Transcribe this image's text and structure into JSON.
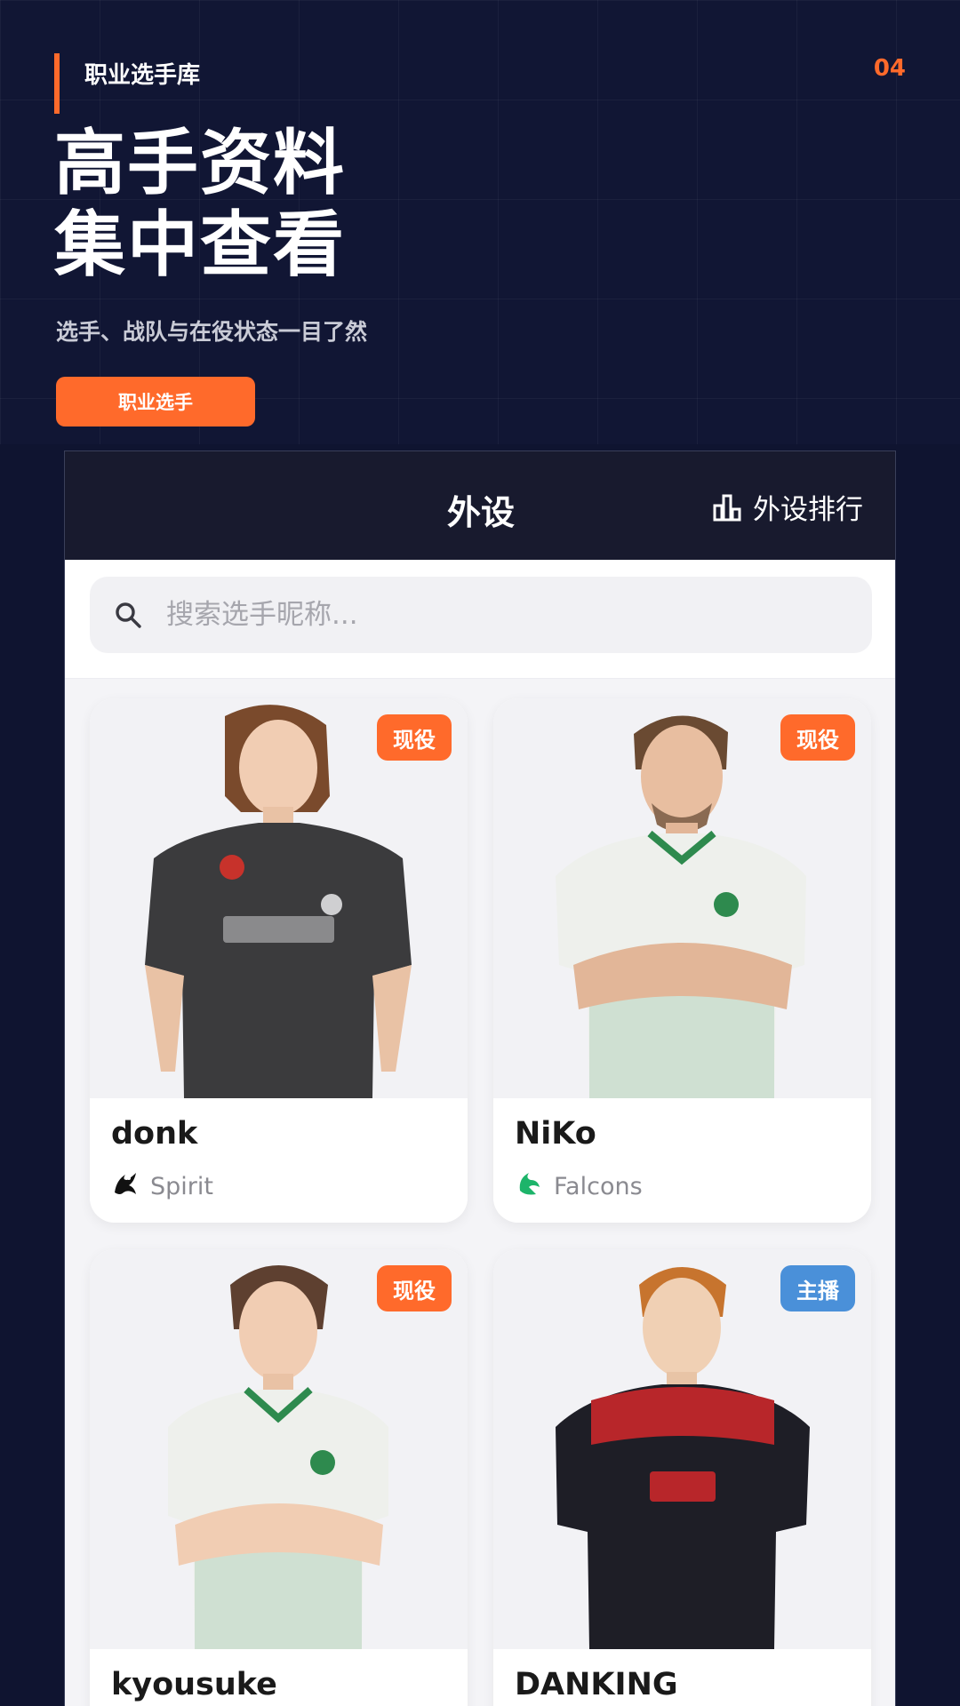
{
  "hero": {
    "kicker": "职业选手库",
    "page_number": "04",
    "headline_line1": "高手资料",
    "headline_line2": "集中查看",
    "subtitle": "选手、战队与在役状态一目了然",
    "cta_label": "职业选手"
  },
  "app": {
    "title": "外设",
    "rank_label": "外设排行",
    "search_placeholder": "搜索选手昵称..."
  },
  "colors": {
    "accent": "#ff6a2b",
    "navy": "#111634",
    "appbar": "#181a2e",
    "badge_active": "#ff6a2b",
    "badge_streamer": "#4a90d9"
  },
  "players": [
    {
      "name": "donk",
      "team": "Spirit",
      "team_icon": "spirit-dragon-icon",
      "status": "现役",
      "jersey": "dark-gray"
    },
    {
      "name": "NiKo",
      "team": "Falcons",
      "team_icon": "falcons-logo-icon",
      "status": "现役",
      "jersey": "white-green"
    },
    {
      "name": "kyousuke",
      "team": "",
      "team_icon": "",
      "status": "现役",
      "jersey": "white-green"
    },
    {
      "name": "DANKING",
      "team": "",
      "team_icon": "",
      "status": "主播",
      "jersey": "black-red"
    }
  ]
}
